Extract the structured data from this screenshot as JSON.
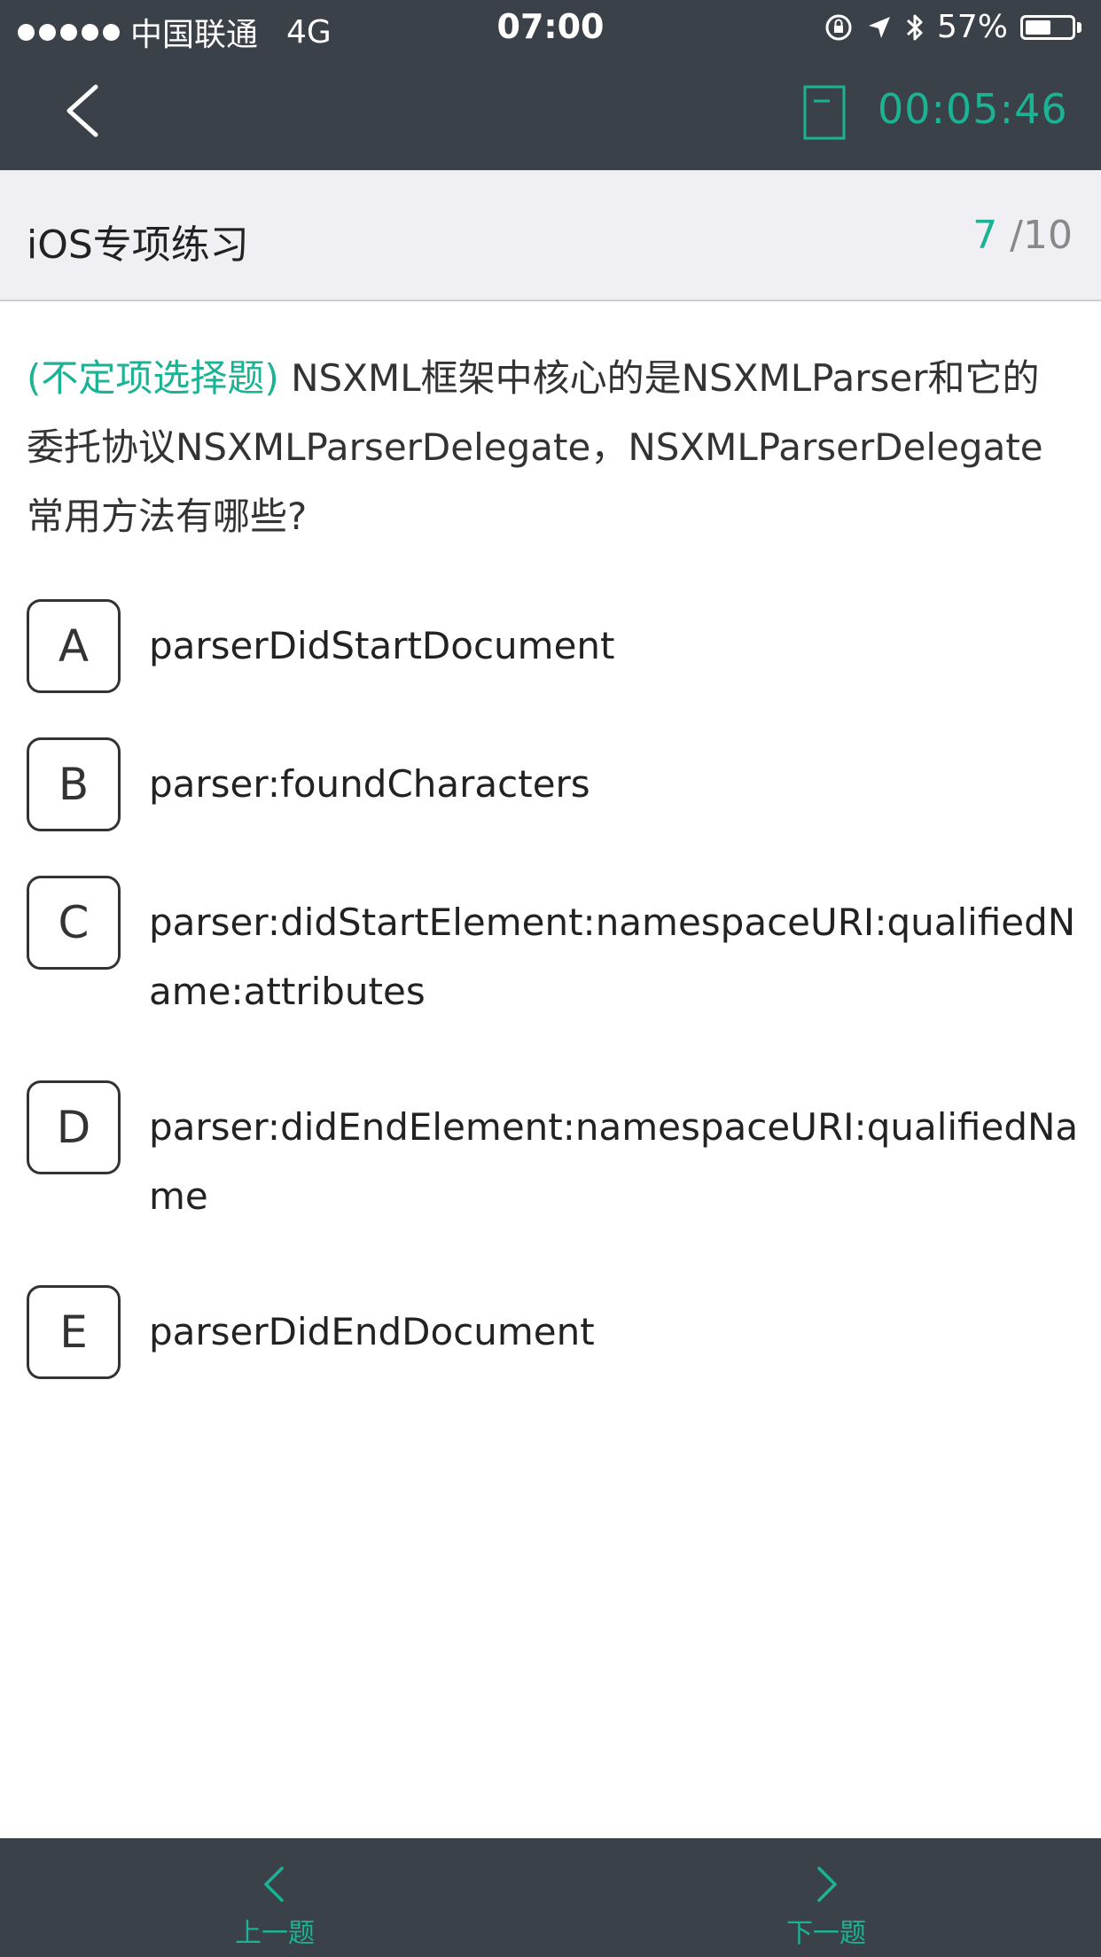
{
  "status_bar": {
    "carrier": "中国联通",
    "network": "4G",
    "time": "07:00",
    "battery": "57%",
    "battery_level": 0.57
  },
  "nav": {
    "timer": "00:05:46"
  },
  "subject": {
    "title": "iOS专项练习",
    "current": "7",
    "total": " /10"
  },
  "question": {
    "type": "(不定项选择题)",
    "text": " NSXML框架中核心的是NSXMLParser和它的委托协议NSXMLParserDelegate，NSXMLParserDelegate常用方法有哪些?"
  },
  "options": [
    {
      "letter": "A",
      "text": "parserDidStartDocument"
    },
    {
      "letter": "B",
      "text": "parser:foundCharacters"
    },
    {
      "letter": "C",
      "text": "parser:didStartElement:namespaceURI:qualifiedName:attributes"
    },
    {
      "letter": "D",
      "text": "parser:didEndElement:namespaceURI:qualifiedName"
    },
    {
      "letter": "E",
      "text": "parserDidEndDocument"
    }
  ],
  "bottom": {
    "prev_label": "上一题",
    "next_label": "下一题"
  },
  "colors": {
    "accent": "#1ab394",
    "bar": "#3b4149",
    "header_bg": "#efeff4"
  }
}
